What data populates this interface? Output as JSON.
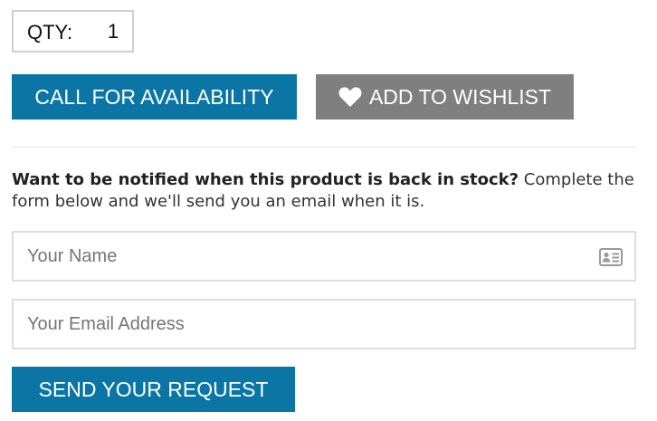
{
  "quantity": {
    "label": "QTY:",
    "value": "1"
  },
  "buttons": {
    "call_for_availability": "CALL FOR AVAILABILITY",
    "add_to_wishlist": "ADD TO WISHLIST",
    "send_request": "SEND YOUR REQUEST"
  },
  "notify": {
    "bold_text": "Want to be notified when this product is back in stock?",
    "text": " Complete the form below and we'll send you an email when it is."
  },
  "form": {
    "name_placeholder": "Your Name",
    "email_placeholder": "Your Email Address"
  },
  "icons": {
    "wishlist": "heart-icon",
    "name_field": "contact-card-icon"
  },
  "colors": {
    "primary_button": "#0b76a5",
    "secondary_button": "#7f7f7f"
  }
}
